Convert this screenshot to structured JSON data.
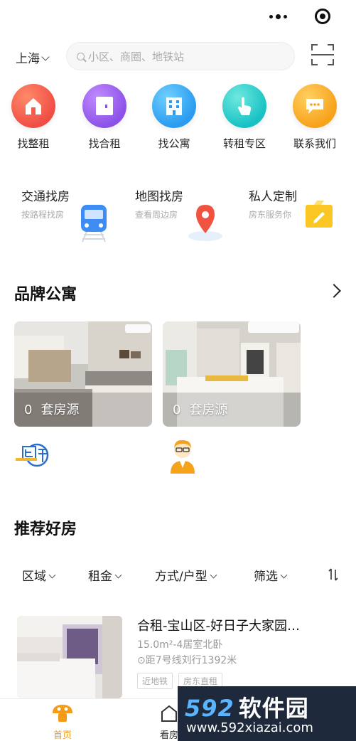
{
  "header": {
    "more_icon": "more-dots-icon",
    "close_icon": "target-close-icon"
  },
  "search": {
    "city": "上海",
    "placeholder": "小区、商圈、地铁站",
    "scan_icon": "scan-icon"
  },
  "categories": [
    {
      "label": "找整租",
      "icon": "house-icon",
      "color": "#f04e45"
    },
    {
      "label": "找合租",
      "icon": "door-icon",
      "color": "#8c52e8"
    },
    {
      "label": "找公寓",
      "icon": "building-icon",
      "color": "#2a9bf0"
    },
    {
      "label": "转租专区",
      "icon": "hand-tap-icon",
      "color": "#18c2c4"
    },
    {
      "label": "联系我们",
      "icon": "chat-bubble-icon",
      "color": "#f7a21b"
    }
  ],
  "quick_links": [
    {
      "title": "交通找房",
      "subtitle": "按路程找房",
      "icon": "train-icon"
    },
    {
      "title": "地图找房",
      "subtitle": "查看周边房",
      "icon": "map-pin-icon"
    },
    {
      "title": "私人定制",
      "subtitle": "房东服务你",
      "icon": "edit-folder-icon"
    }
  ],
  "brand_section": {
    "title": "品牌公寓",
    "cards": [
      {
        "count": "0",
        "unit": "套房源"
      },
      {
        "count": "0",
        "unit": "套房源"
      }
    ],
    "logos": [
      "brand-logo-icon",
      "agent-avatar-icon"
    ]
  },
  "recommend_section": {
    "title": "推荐好房",
    "filters": [
      "区域",
      "租金",
      "方式/户型",
      "筛选"
    ],
    "sort_icon": "sort-icon"
  },
  "listing": {
    "title": "合租-宝山区-好日子大家园…",
    "sub": "15.0m²-4居室北卧",
    "distance": "距7号线刘行1392米",
    "tags": [
      "近地铁",
      "房东直租"
    ]
  },
  "tabbar": {
    "home": "首页",
    "viewing": "看房"
  },
  "watermark": {
    "brand": "592",
    "brand_cn": "软件园",
    "url": "www.592xiazai.com"
  },
  "colors": {
    "accent": "#f7a21b",
    "text": "#222222"
  }
}
